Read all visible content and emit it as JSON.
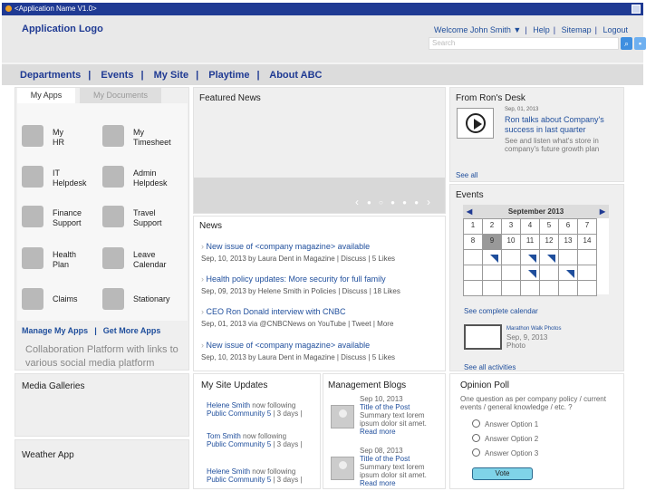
{
  "window": {
    "title": "<Application Name V1.0>"
  },
  "header": {
    "logo": "Application Logo",
    "welcome": "Welcome John Smith",
    "links": [
      "Help",
      "Sitemap",
      "Logout"
    ],
    "search_placeholder": "Search"
  },
  "nav": [
    "Departments",
    "Events",
    "My Site",
    "Playtime",
    "About ABC"
  ],
  "apps": {
    "tabs": [
      "My Apps",
      "My Documents"
    ],
    "items": [
      "My\nHR",
      "My\nTimesheet",
      "IT\nHelpdesk",
      "Admin\nHelpdesk",
      "Finance\nSupport",
      "Travel\nSupport",
      "Health\nPlan",
      "Leave\nCalendar",
      "Claims",
      "Stationary"
    ],
    "manage": "Manage My Apps",
    "more": "Get More Apps",
    "collab": "Collaboration Platform with links to various social media platform"
  },
  "media": "Media Galleries",
  "weather": "Weather App",
  "featured": {
    "title": "Featured News"
  },
  "news": {
    "title": "News",
    "items": [
      {
        "title": "New issue of <company magazine> available",
        "meta": "Sep, 10, 2013 by Laura Dent in Magazine  |  Discuss  |  5 Likes"
      },
      {
        "title": "Health policy updates: More security for full family",
        "meta": "Sep, 09, 2013 by Helene Smith in Policies  |  Discuss  |  18 Likes"
      },
      {
        "title": "CEO Ron Donald interview with CNBC",
        "meta": "Sep, 01, 2013 via @CNBCNews on  YouTube  |  Tweet  |  More"
      },
      {
        "title": "New issue of <company magazine> available",
        "meta": "Sep, 10, 2013 by Laura Dent in Magazine  |  Discuss  |  5 Likes"
      }
    ]
  },
  "updates": {
    "title": "My Site Updates",
    "items": [
      {
        "who": "Helene Smith",
        "rest": "now following",
        "line2": "Public Community 5",
        "ago": "| 3 days |"
      },
      {
        "who": "Tom Smith",
        "rest": "now following",
        "line2": "Public Community 5",
        "ago": "| 3 days |"
      },
      {
        "who": "Helene Smith",
        "rest": "now following",
        "line2": "Public Community 5",
        "ago": "| 3 days |"
      }
    ]
  },
  "blogs": {
    "title": "Management Blogs",
    "items": [
      {
        "date": "Sep 10, 2013",
        "title": "Title of the Post",
        "summary": "Summary text lorem ipsum dolor sit amet.",
        "more": "Read more"
      },
      {
        "date": "Sep 08, 2013",
        "title": "Title of the Post",
        "summary": "Summary text lorem ipsum dolor sit amet.",
        "more": "Read more"
      }
    ]
  },
  "ron": {
    "title": "From Ron's Desk",
    "date": "Sep, 01, 2013",
    "headline": "Ron talks about Company's success in last quarter",
    "desc": "See and listen what's store in company's future growth plan",
    "seeall": "See all"
  },
  "events": {
    "title": "Events",
    "month": "September 2013",
    "row1": [
      "1",
      "2",
      "3",
      "4",
      "5",
      "6",
      "7"
    ],
    "row2": [
      "8",
      "9",
      "10",
      "11",
      "12",
      "13",
      "14"
    ],
    "complete": "See complete calendar",
    "photo_title": "Marathon Walk Photos",
    "photo_date": "Sep, 9, 2013",
    "photo_type": "Photo",
    "seeall": "See all activities"
  },
  "poll": {
    "title": "Opinion Poll",
    "question": "One question as per company policy / current events / general knowledge / etc. ?",
    "options": [
      "Answer Option 1",
      "Answer Option 2",
      "Answer Option 3"
    ],
    "vote": "Vote"
  }
}
